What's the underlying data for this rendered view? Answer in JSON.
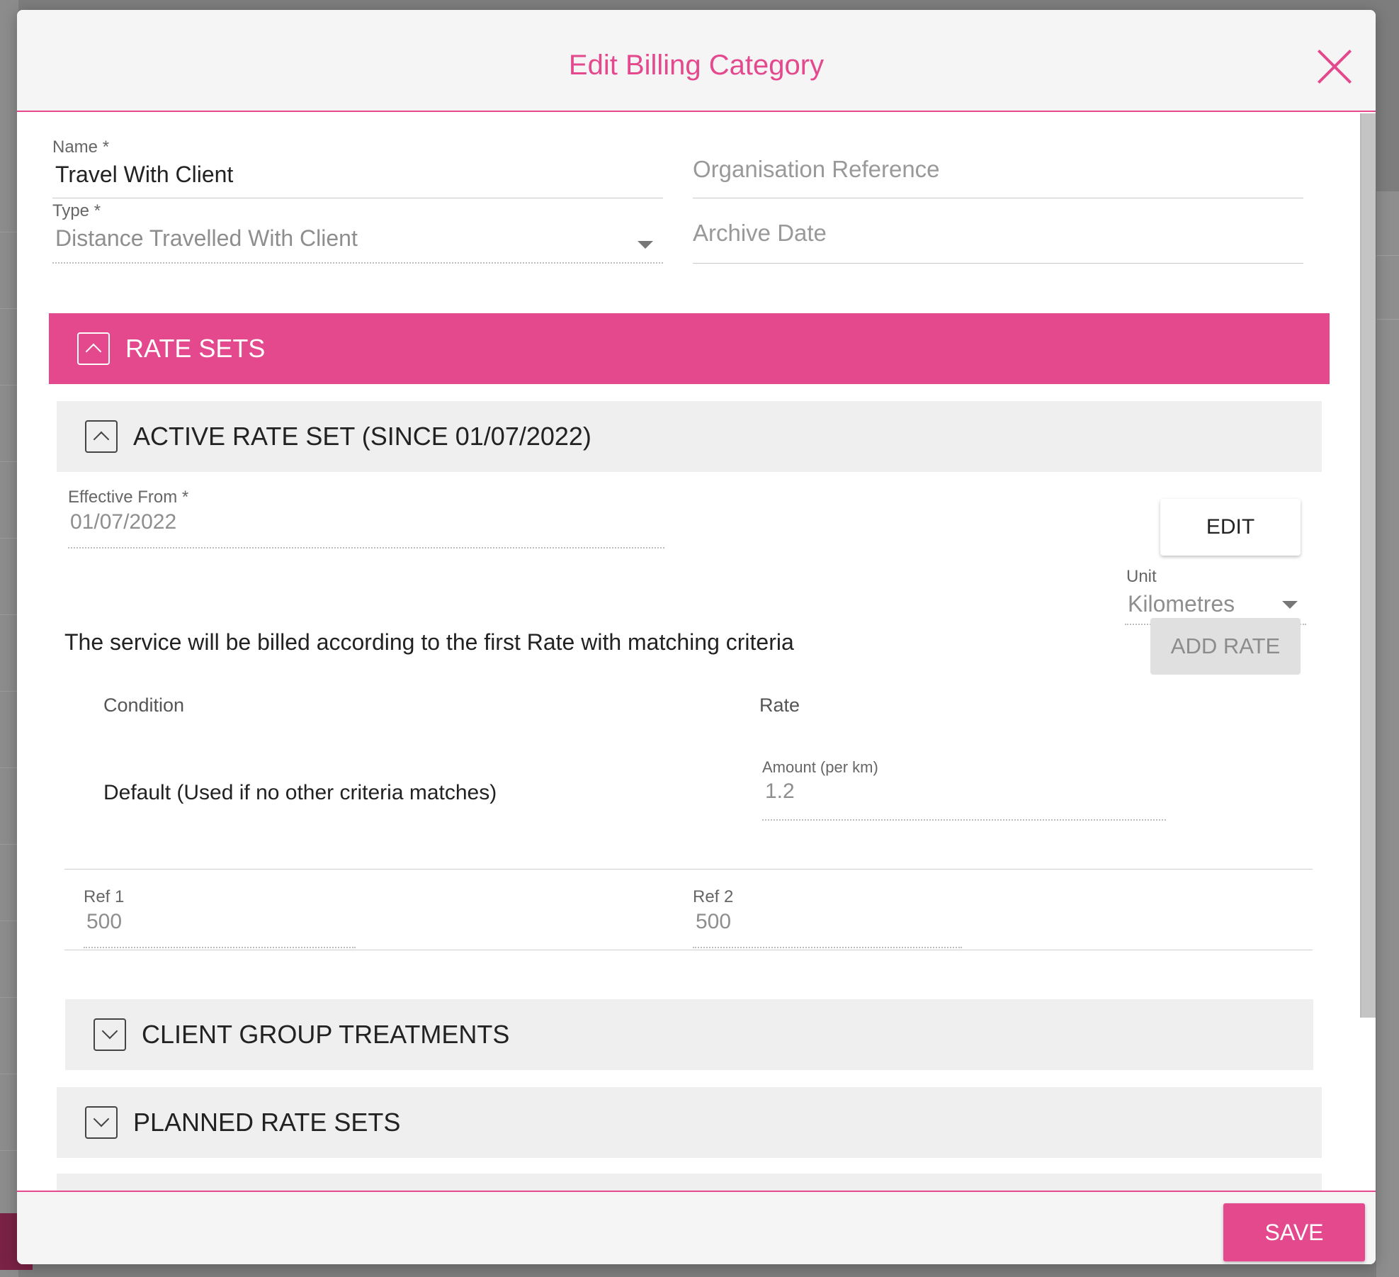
{
  "modal": {
    "title": "Edit Billing Category",
    "close_icon": "close-icon"
  },
  "form": {
    "name_label": "Name *",
    "name_value": "Travel With Client",
    "type_label": "Type *",
    "type_value": "Distance Travelled With Client",
    "org_ref_placeholder": "Organisation Reference",
    "archive_date_placeholder": "Archive Date"
  },
  "rate_sets": {
    "header": "RATE SETS",
    "active": {
      "header": "ACTIVE RATE SET (SINCE 01/07/2022)",
      "effective_from_label": "Effective From *",
      "effective_from_value": "01/07/2022",
      "edit_label": "EDIT",
      "unit_label": "Unit",
      "unit_value": "Kilometres",
      "note": "The service will be billed according to the first Rate with matching criteria",
      "add_rate_label": "ADD RATE",
      "table": {
        "condition_header": "Condition",
        "rate_header": "Rate",
        "row": {
          "condition": "Default (Used if no other criteria matches)",
          "amount_label": "Amount (per km)",
          "amount_value": "1.2",
          "ref1_label": "Ref 1",
          "ref1_value": "500",
          "ref2_label": "Ref 2",
          "ref2_value": "500"
        }
      }
    },
    "client_group_header": "CLIENT GROUP TREATMENTS",
    "planned_header": "PLANNED RATE SETS"
  },
  "footer": {
    "save_label": "SAVE"
  },
  "colors": {
    "accent": "#e4498e",
    "section_grey": "#efefef"
  }
}
